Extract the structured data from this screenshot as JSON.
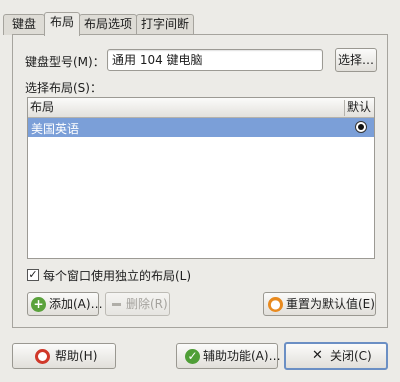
{
  "tabs": [
    {
      "label": "键盘",
      "active": false
    },
    {
      "label": "布局",
      "active": true
    },
    {
      "label": "布局选项",
      "active": false
    },
    {
      "label": "打字间断",
      "active": false
    }
  ],
  "layout_tab": {
    "model_label": "键盘型号(M)：",
    "model_value": "通用 104 键电脑",
    "choose_button": "选择…",
    "select_layout_label": "选择布局(S)：",
    "columns": [
      "布局",
      "默认"
    ],
    "rows": [
      {
        "layout": "美国英语",
        "default": true,
        "selected": true
      }
    ],
    "per_window_checkbox": {
      "label": "每个窗口使用独立的布局(L)",
      "checked": true
    },
    "add_button": "添加(A)…",
    "remove_button": "删除(R)",
    "reset_button": "重置为默认值(E)"
  },
  "footer": {
    "help_button": "帮助(H)",
    "accessibility_button": "辅助功能(A)…",
    "close_button": "关闭(C)"
  },
  "icons": {
    "add": "plus-circle-icon",
    "remove": "minus-icon",
    "reset": "reset-icon",
    "help": "help-lifebuoy-icon",
    "accessibility": "accessibility-icon",
    "close": "close-x-icon"
  },
  "colors": {
    "selection": "#7b9fd8",
    "window_bg": "#ecebe7",
    "default_button_border": "#6b8fc4"
  }
}
